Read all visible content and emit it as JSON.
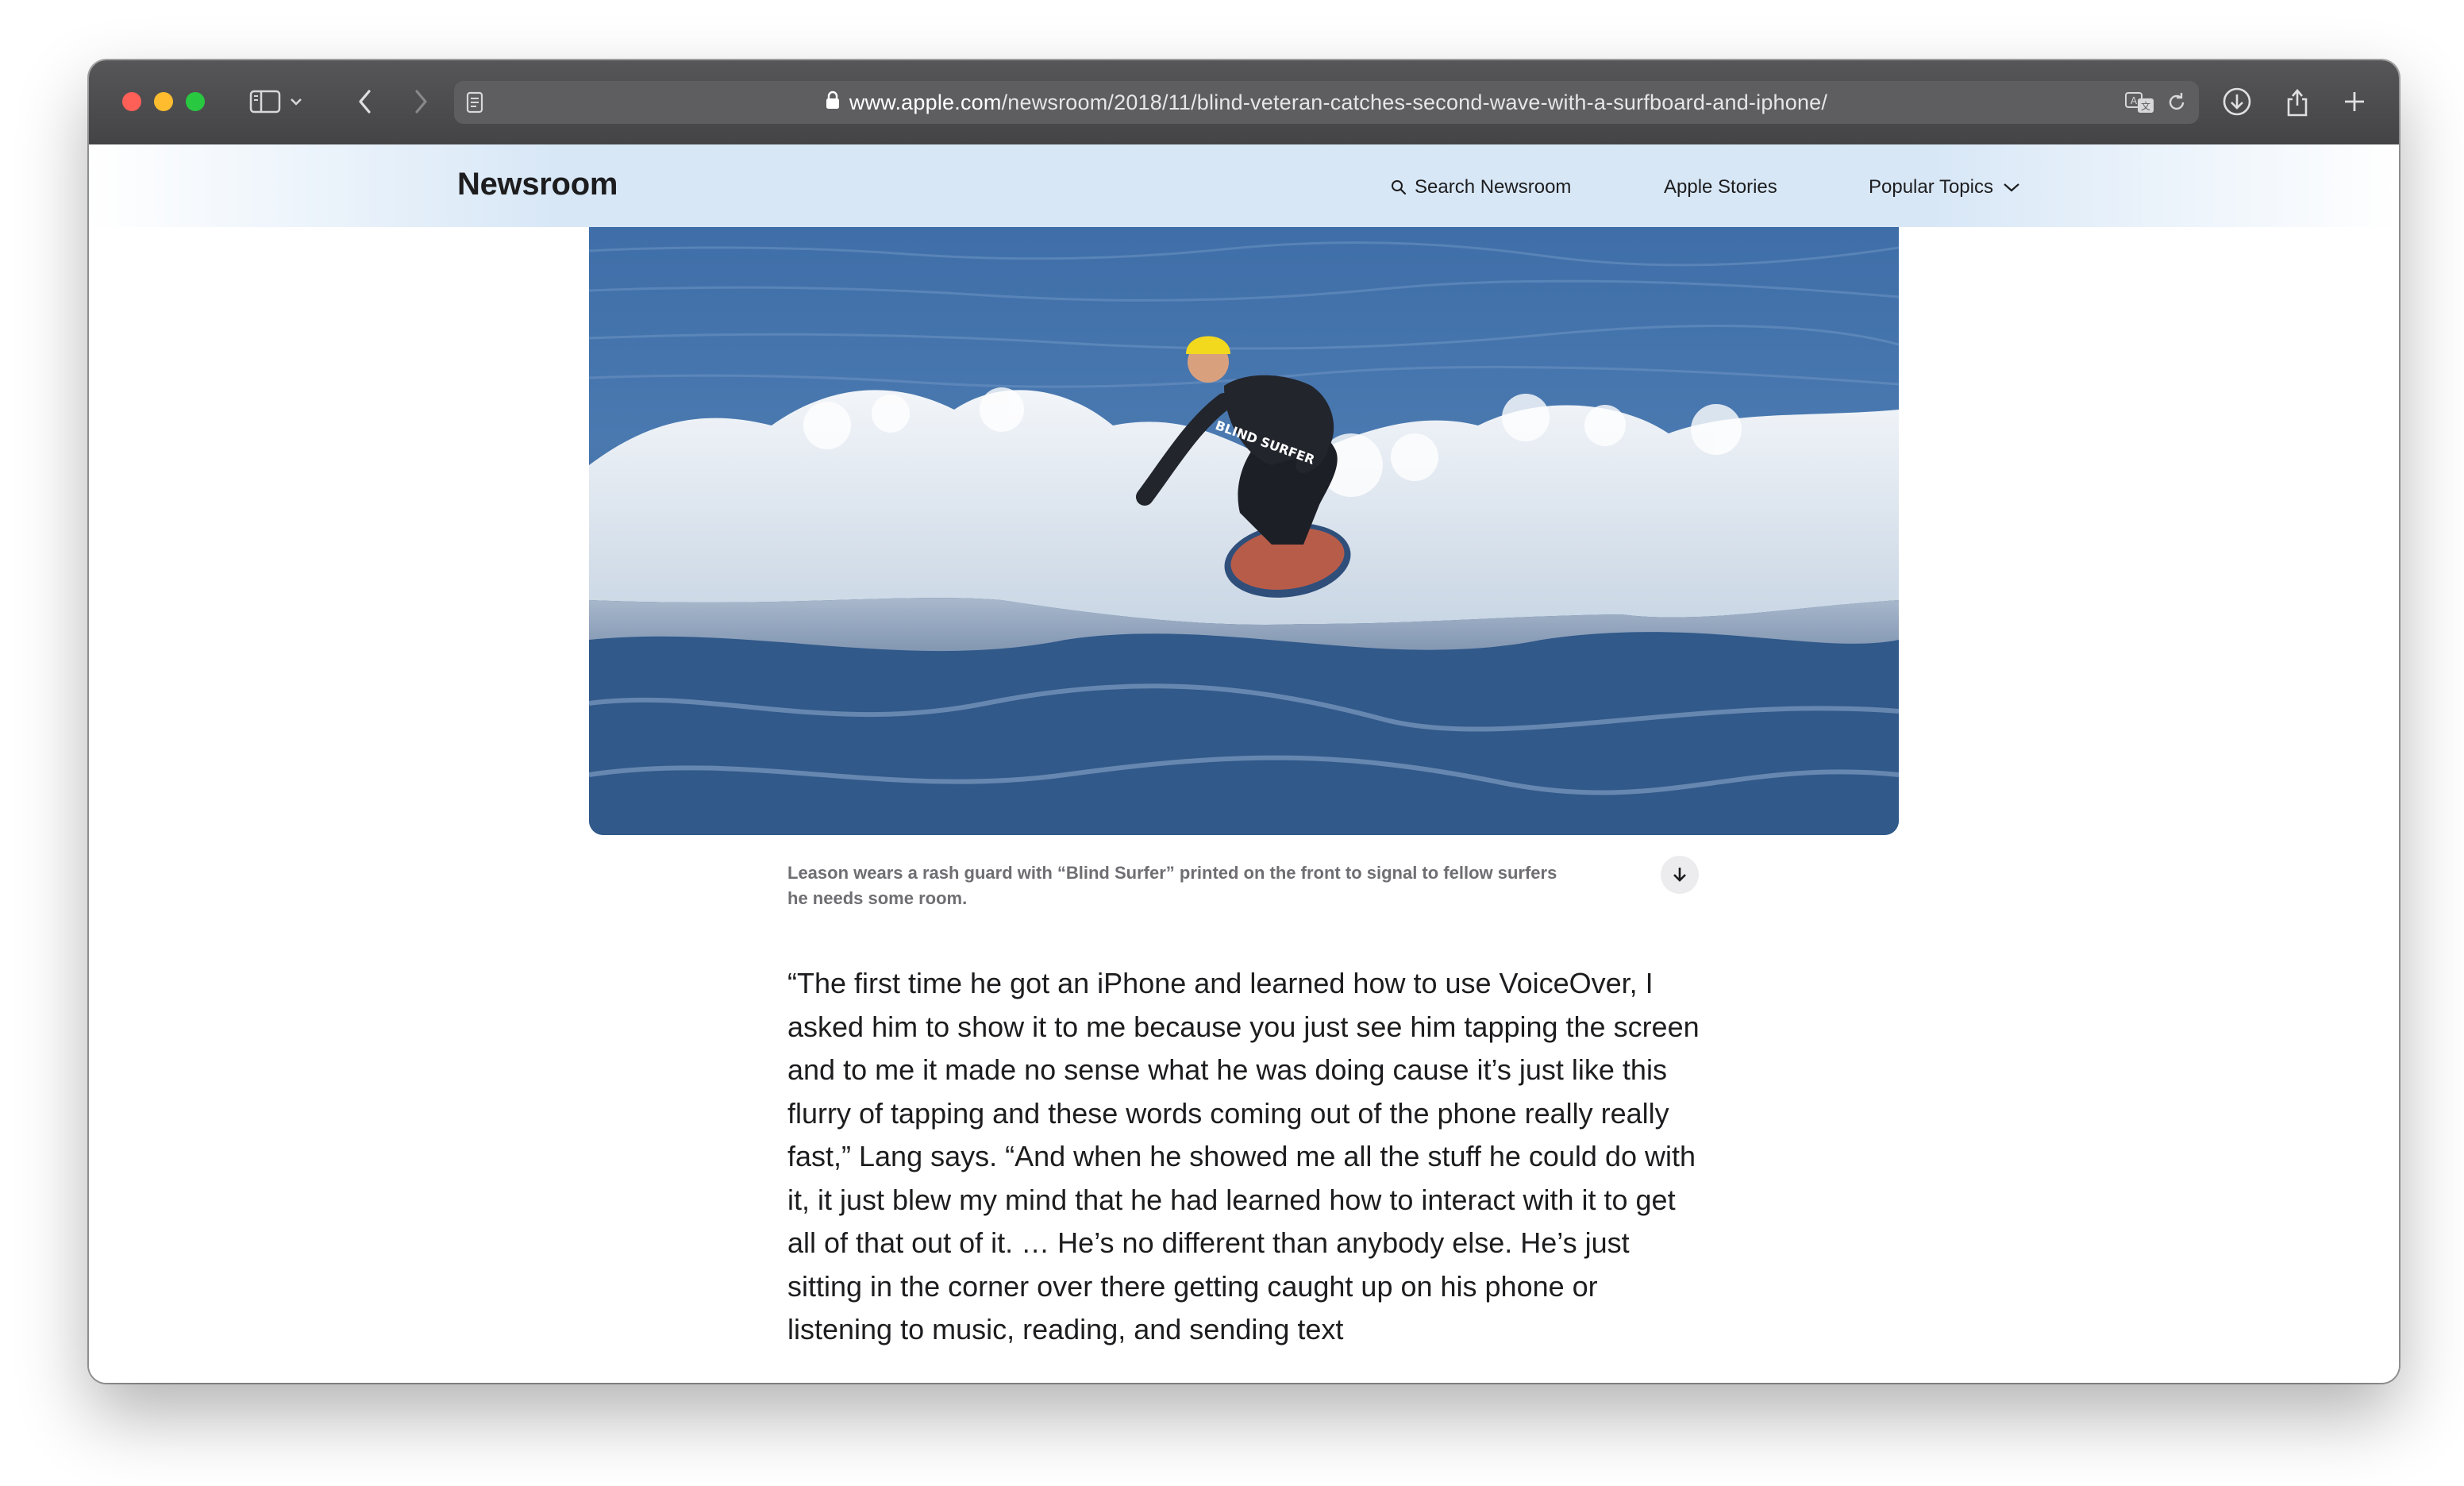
{
  "browser": {
    "url_host": "www.apple.com",
    "url_path": "/newsroom/2018/11/blind-veteran-catches-second-wave-with-a-surfboard-and-iphone/"
  },
  "nav": {
    "brand": "Newsroom",
    "search_label": "Search Newsroom",
    "stories_label": "Apple Stories",
    "topics_label": "Popular Topics"
  },
  "hero": {
    "wetsuit_text": "BLIND SURFER"
  },
  "caption": "Leason wears a rash guard with “Blind Surfer” printed on the front to signal to fellow surfers he needs some room.",
  "article": {
    "paragraph": "“The first time he got an iPhone and learned how to use VoiceOver, I asked him to show it to me because you just see him tapping the screen and to me it made no sense what he was doing cause it’s just like this flurry of tapping and these words coming out of the phone really really fast,” Lang says. “And when he showed me all the stuff he could do with it, it just blew my mind that he had learned how to interact with it to get all of that out of it. … He’s no different than anybody else. He’s just sitting in the corner over there getting caught up on his phone or listening to music, reading, and sending text"
  },
  "colors": {
    "toolbar": "#4a4a4c",
    "nav_tint": "#d6e6f6",
    "text": "#1d1d1f",
    "caption": "#6e6e73"
  }
}
